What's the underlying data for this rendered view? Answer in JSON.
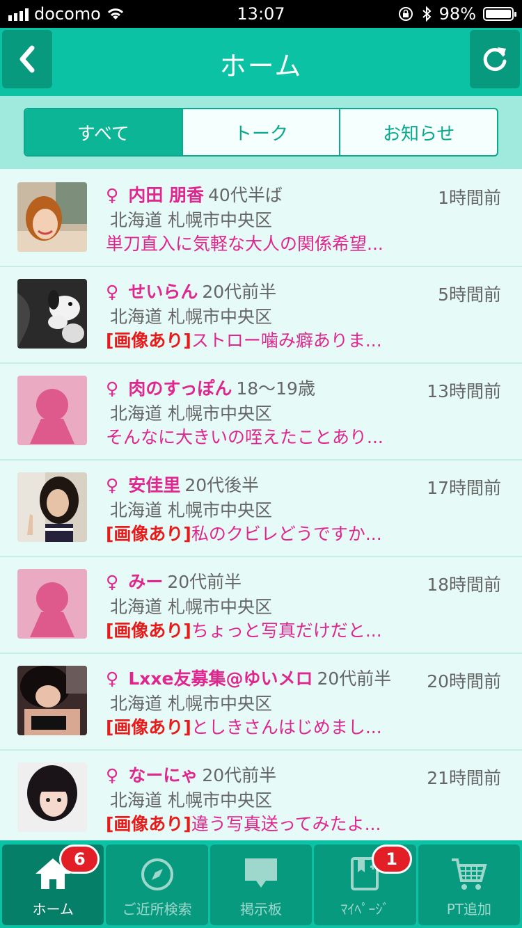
{
  "status_bar": {
    "carrier": "docomo",
    "time": "13:07",
    "battery": "98%"
  },
  "header": {
    "title": "ホーム"
  },
  "tabs": [
    {
      "label": "すべて",
      "active": true
    },
    {
      "label": "トーク",
      "active": false
    },
    {
      "label": "お知らせ",
      "active": false
    }
  ],
  "posts": [
    {
      "gender": "♀",
      "name": "内田 朋香",
      "age": "40代半ば",
      "location": "北海道 札幌市中央区",
      "tag": "",
      "message": "単刀直入に気軽な大人の関係希望...",
      "time": "1時間前",
      "avatar": "photo-1"
    },
    {
      "gender": "♀",
      "name": "せいらん",
      "age": "20代前半",
      "location": "北海道 札幌市中央区",
      "tag": "[画像あり]",
      "message": "ストロー噛み癖ありま...",
      "time": "5時間前",
      "avatar": "photo-2"
    },
    {
      "gender": "♀",
      "name": "肉のすっぽん",
      "age": "18〜19歳",
      "location": "北海道 札幌市中央区",
      "tag": "",
      "message": "そんなに大きいの咥えたことあり...",
      "time": "13時間前",
      "avatar": "default"
    },
    {
      "gender": "♀",
      "name": "安佳里",
      "age": "20代後半",
      "location": "北海道 札幌市中央区",
      "tag": "[画像あり]",
      "message": "私のクビレどうですか...",
      "time": "17時間前",
      "avatar": "photo-3"
    },
    {
      "gender": "♀",
      "name": "みー",
      "age": "20代前半",
      "location": "北海道 札幌市中央区",
      "tag": "[画像あり]",
      "message": "ちょっと写真だけだと...",
      "time": "18時間前",
      "avatar": "default"
    },
    {
      "gender": "♀",
      "name": "Lxxe友募集@ゆいメロ",
      "age": "20代前半",
      "location": "北海道 札幌市中央区",
      "tag": "[画像あり]",
      "message": "としきさんはじめまし...",
      "time": "20時間前",
      "avatar": "photo-4"
    },
    {
      "gender": "♀",
      "name": "なーにゃ",
      "age": "20代前半",
      "location": "北海道 札幌市中央区",
      "tag": "[画像あり]",
      "message": "違う写真送ってみたよ...",
      "time": "21時間前",
      "avatar": "photo-5"
    }
  ],
  "tabbar": [
    {
      "label": "ホーム",
      "icon": "home-icon",
      "badge": "6",
      "active": true
    },
    {
      "label": "ご近所検索",
      "icon": "compass-icon",
      "badge": "",
      "active": false
    },
    {
      "label": "掲示板",
      "icon": "message-board-icon",
      "badge": "",
      "active": false
    },
    {
      "label": "ﾏｲﾍﾟｰｼﾞ",
      "icon": "bookmark-book-icon",
      "badge": "1",
      "active": false
    },
    {
      "label": "PT追加",
      "icon": "cart-icon",
      "badge": "",
      "active": false
    }
  ],
  "colors": {
    "accent": "#0bc2a4",
    "accent_dark": "#089a7f",
    "pink": "#e0268f",
    "red": "#e81a1a"
  }
}
